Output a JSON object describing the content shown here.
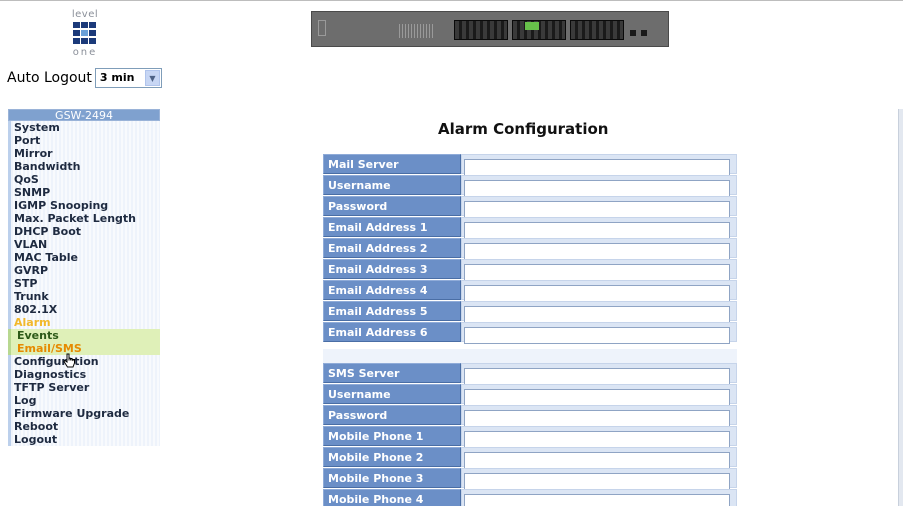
{
  "logo": {
    "top_text": "level",
    "bottom_text": "one"
  },
  "auto_logout": {
    "label": "Auto Logout",
    "value": "3 min"
  },
  "menu": {
    "header": "GSW-2494",
    "items": [
      "System",
      "Port",
      "Mirror",
      "Bandwidth",
      "QoS",
      "SNMP",
      "IGMP Snooping",
      "Max. Packet Length",
      "DHCP Boot",
      "VLAN",
      "MAC Table",
      "GVRP",
      "STP",
      "Trunk",
      "802.1X",
      "Alarm"
    ],
    "alarm_sub": [
      "Events",
      "Email/SMS"
    ],
    "items_after": [
      "Configuration",
      "Diagnostics",
      "TFTP Server",
      "Log",
      "Firmware Upgrade",
      "Reboot",
      "Logout"
    ]
  },
  "page_title": "Alarm Configuration",
  "email_fields": [
    "Mail Server",
    "Username",
    "Password",
    "Email Address 1",
    "Email Address 2",
    "Email Address 3",
    "Email Address 4",
    "Email Address 5",
    "Email Address 6"
  ],
  "sms_fields": [
    "SMS Server",
    "Username",
    "Password",
    "Mobile Phone 1",
    "Mobile Phone 2",
    "Mobile Phone 3",
    "Mobile Phone 4"
  ],
  "colors": {
    "label_bg": "#6b8fc7",
    "menu_header_bg": "#7fa1cf",
    "alarm_text": "#f2b82a",
    "active_sub_text": "#e68a00",
    "sub_bg": "#dff0b8"
  }
}
